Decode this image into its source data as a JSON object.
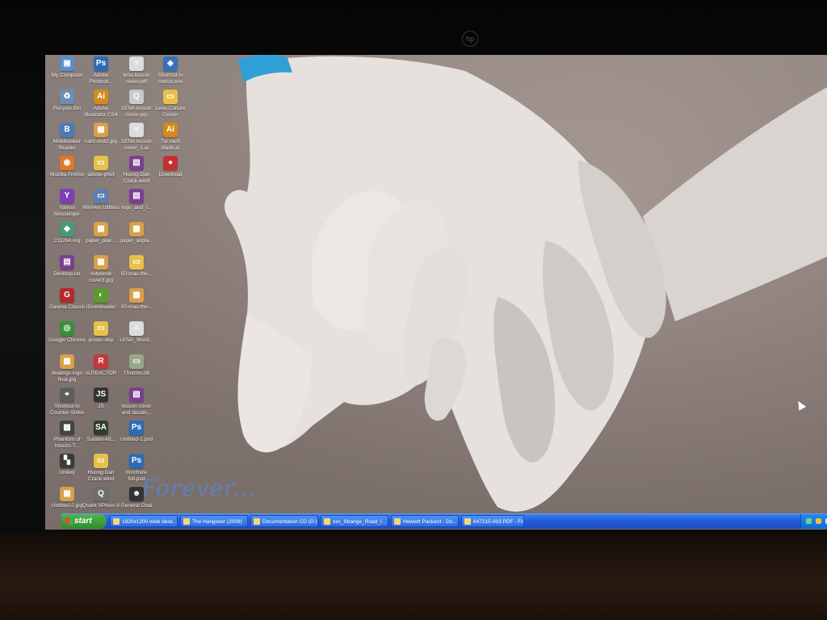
{
  "desktop": {
    "icons": [
      {
        "label": "My Computer",
        "glyph": "▣",
        "color": "#5a8fd0"
      },
      {
        "label": "Adobe Photosh...",
        "glyph": "Ps",
        "color": "#2d6bb3"
      },
      {
        "label": "lena lesson cover.pdf",
        "glyph": "≡",
        "color": "#dcdcdc"
      },
      {
        "label": "Shortcut to netcut.exe",
        "glyph": "◈",
        "color": "#3b6fb5"
      },
      {
        "label": "Recycle Bin",
        "glyph": "♻",
        "color": "#6c8fb3"
      },
      {
        "label": "Adobe Illustrator CS4",
        "glyph": "Ai",
        "color": "#d48a1c"
      },
      {
        "label": "LENA lesson cover.qxp",
        "glyph": "Q",
        "color": "#c9c9c9"
      },
      {
        "label": "Lena Culture Center",
        "glyph": "▭",
        "color": "#e6c04a"
      },
      {
        "label": "Mobibooker Reader",
        "glyph": "B",
        "color": "#4d7bb3"
      },
      {
        "label": "card visit2.jpg",
        "glyph": "▦",
        "color": "#d9a04a"
      },
      {
        "label": "LENA lesson cover_1.ai",
        "glyph": "≡",
        "color": "#dcdcdc"
      },
      {
        "label": "Tui xach blank.ai",
        "glyph": "Ai",
        "color": "#d48a1c"
      },
      {
        "label": "Mozilla Firefox",
        "glyph": "◉",
        "color": "#e07a22"
      },
      {
        "label": "adobe-phot",
        "glyph": "▭",
        "color": "#e6c04a"
      },
      {
        "label": "Huong Dan Crack.wind",
        "glyph": "▤",
        "color": "#7a3f8f"
      },
      {
        "label": "Download",
        "glyph": "●",
        "color": "#c62f2f"
      },
      {
        "label": "Yahoo! Messenger",
        "glyph": "Y",
        "color": "#7d3fb2"
      },
      {
        "label": "WinHex Utilities",
        "glyph": "▭",
        "color": "#5a7fb0"
      },
      {
        "label": "logo_and_l...",
        "glyph": "▤",
        "color": "#7a3f8f"
      },
      {
        "label": "",
        "glyph": "",
        "color": "transparent"
      },
      {
        "label": "211204.reg",
        "glyph": "◆",
        "color": "#4a9a7a"
      },
      {
        "label": "paper_plan...",
        "glyph": "▦",
        "color": "#d9a04a"
      },
      {
        "label": "paper_airpla...",
        "glyph": "▦",
        "color": "#d9a04a"
      },
      {
        "label": "",
        "glyph": "",
        "color": "transparent"
      },
      {
        "label": "Desktop.rar",
        "glyph": "▤",
        "color": "#7a3f8f"
      },
      {
        "label": "notebook cover3.jpg",
        "glyph": "▦",
        "color": "#d9a04a"
      },
      {
        "label": "50-mau-the...",
        "glyph": "▭",
        "color": "#e6c04a"
      },
      {
        "label": "",
        "glyph": "",
        "color": "transparent"
      },
      {
        "label": "Garena Classic",
        "glyph": "G",
        "color": "#b22a2a"
      },
      {
        "label": "IDownloader",
        "glyph": "◐",
        "color": "#5b9b2f"
      },
      {
        "label": "50-mau-the...",
        "glyph": "▦",
        "color": "#d9a04a"
      },
      {
        "label": "",
        "glyph": "",
        "color": "transparent"
      },
      {
        "label": "Google Chrome",
        "glyph": "◎",
        "color": "#3a8f3a"
      },
      {
        "label": "poster-dep",
        "glyph": "▭",
        "color": "#e6c04a"
      },
      {
        "label": "LENA_Word...",
        "glyph": "≡",
        "color": "#dcdcdc"
      },
      {
        "label": "",
        "glyph": "",
        "color": "transparent"
      },
      {
        "label": "dealings logo final.jpg",
        "glyph": "▦",
        "color": "#d9a04a"
      },
      {
        "label": "nLREACTOR",
        "glyph": "R",
        "color": "#c23a3a"
      },
      {
        "label": "Thumbs.db",
        "glyph": "▭",
        "color": "#9aa68a"
      },
      {
        "label": "",
        "glyph": "",
        "color": "transparent"
      },
      {
        "label": "Shortcut to Counter-Strike",
        "glyph": "⌖",
        "color": "#5e5e5e"
      },
      {
        "label": "JS",
        "glyph": "JS",
        "color": "#333333"
      },
      {
        "label": "lesson cover and decals...",
        "glyph": "▤",
        "color": "#7a3f8f"
      },
      {
        "label": "",
        "glyph": "",
        "color": "transparent"
      },
      {
        "label": "Phantom of Insects T...",
        "glyph": "▩",
        "color": "#444444"
      },
      {
        "label": "SuddenAtt...",
        "glyph": "SA",
        "color": "#2f3f2f"
      },
      {
        "label": "Untitled-1.psd",
        "glyph": "Ps",
        "color": "#2d6bb3"
      },
      {
        "label": "",
        "glyph": "",
        "color": "transparent"
      },
      {
        "label": "Unikey",
        "glyph": "▚",
        "color": "#3a3a3a"
      },
      {
        "label": "Huong Dan Crack.wind",
        "glyph": "▭",
        "color": "#e6c04a"
      },
      {
        "label": "brochure full.psd",
        "glyph": "Ps",
        "color": "#2d6bb3"
      },
      {
        "label": "",
        "glyph": "",
        "color": "transparent"
      },
      {
        "label": "Untitled-2.jpg",
        "glyph": "▦",
        "color": "#d9a04a"
      },
      {
        "label": "Quark XPress 8",
        "glyph": "Q",
        "color": "#6d6d6d"
      },
      {
        "label": "General Chat",
        "glyph": "☻",
        "color": "#333333"
      }
    ]
  },
  "wallpaper": {
    "caption": "Forever..."
  },
  "taskbar": {
    "start_label": "start",
    "tasks": [
      {
        "label": "1920x1200 wide desk..."
      },
      {
        "label": "The Hangover (2009)"
      },
      {
        "label": "Documentation CD (G:)"
      },
      {
        "label": "xxx_Strange_Road_I..."
      },
      {
        "label": "Hewlett Packard - Do..."
      },
      {
        "label": "647215-003.PDF - Fo..."
      }
    ]
  },
  "monitor": {
    "logo": "hp"
  }
}
